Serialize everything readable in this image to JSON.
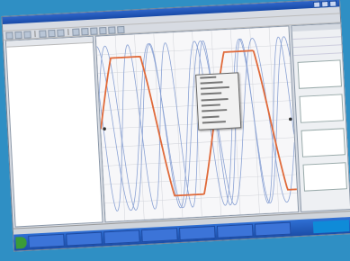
{
  "window": {
    "title": ""
  },
  "menu": [],
  "tree": {
    "header": "",
    "items": []
  },
  "context_menu": {
    "items": []
  },
  "properties": {
    "header": ""
  },
  "status": "",
  "taskbar": {
    "start": "",
    "tasks": [],
    "clock": ""
  },
  "colors": {
    "primary_signal": "#e06a3a",
    "secondary_signal": "#8aa2d4",
    "grid": "#d2d4da"
  },
  "signals": {
    "amplitude": 1.0
  }
}
